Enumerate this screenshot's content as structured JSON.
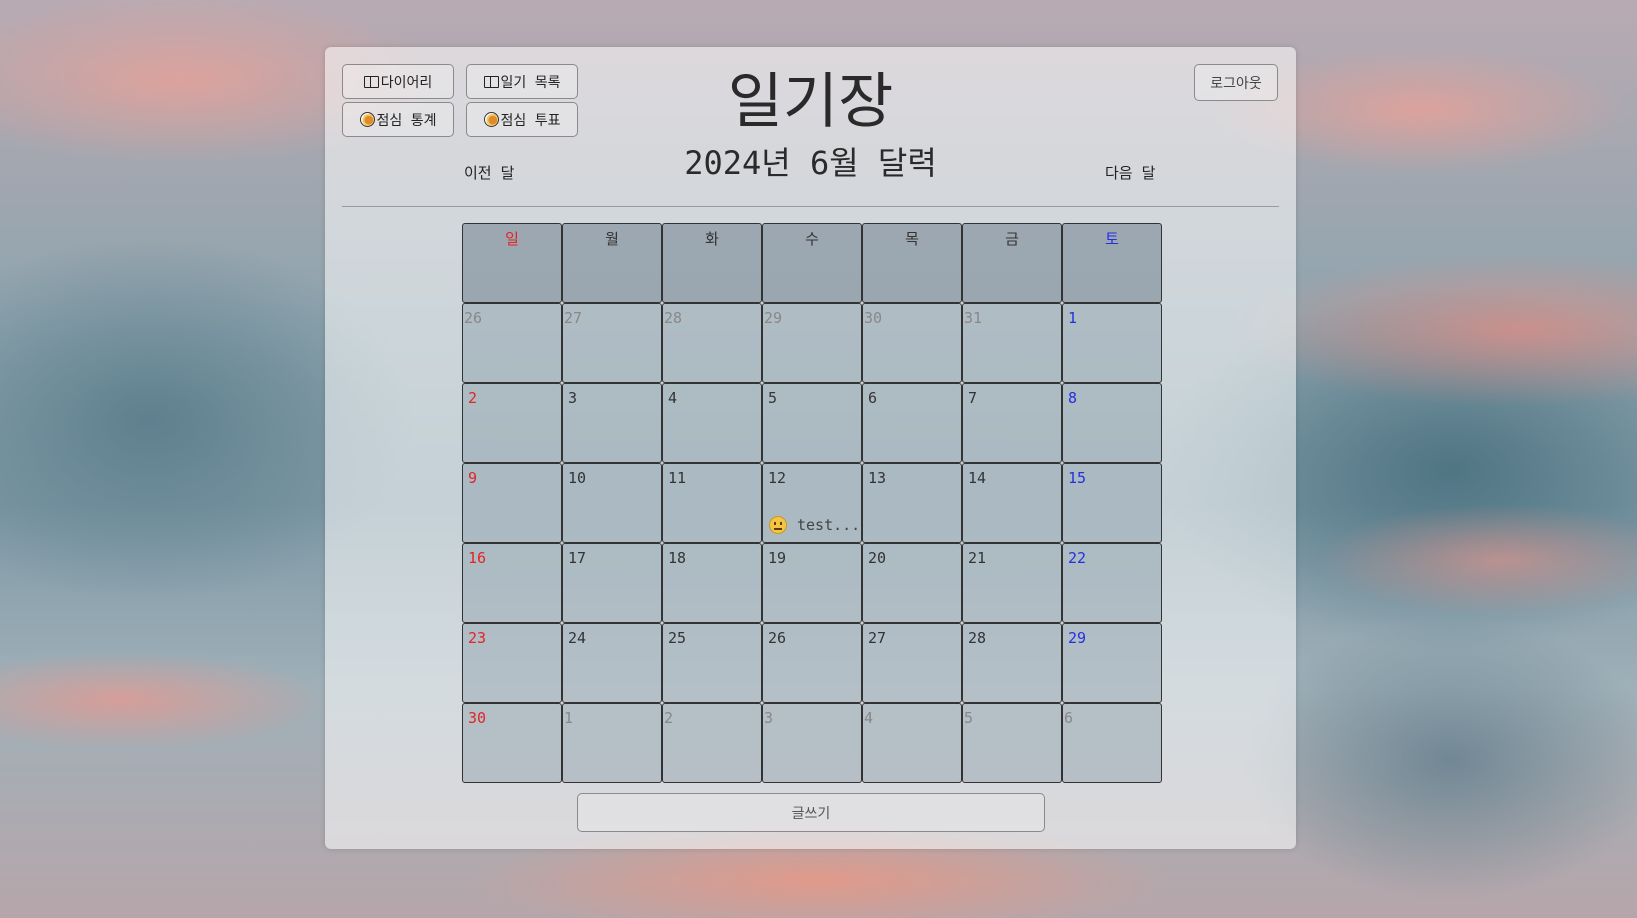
{
  "nav": {
    "diary": "다이어리",
    "diary_list": "일기 목록",
    "lunch_stats": "점심 통계",
    "lunch_vote": "점심 투표",
    "logout": "로그아웃"
  },
  "header": {
    "title": "일기장",
    "month_title": "2024년 6월 달력",
    "prev": "이전 달",
    "next": "다음 달"
  },
  "calendar": {
    "weekdays": [
      "일",
      "월",
      "화",
      "수",
      "목",
      "금",
      "토"
    ],
    "weeks": [
      [
        {
          "d": "26",
          "other": true
        },
        {
          "d": "27",
          "other": true
        },
        {
          "d": "28",
          "other": true
        },
        {
          "d": "29",
          "other": true
        },
        {
          "d": "30",
          "other": true
        },
        {
          "d": "31",
          "other": true
        },
        {
          "d": "1"
        }
      ],
      [
        {
          "d": "2"
        },
        {
          "d": "3"
        },
        {
          "d": "4"
        },
        {
          "d": "5"
        },
        {
          "d": "6"
        },
        {
          "d": "7"
        },
        {
          "d": "8"
        }
      ],
      [
        {
          "d": "9"
        },
        {
          "d": "10"
        },
        {
          "d": "11"
        },
        {
          "d": "12",
          "entry": "test..."
        },
        {
          "d": "13"
        },
        {
          "d": "14"
        },
        {
          "d": "15"
        }
      ],
      [
        {
          "d": "16"
        },
        {
          "d": "17"
        },
        {
          "d": "18"
        },
        {
          "d": "19"
        },
        {
          "d": "20"
        },
        {
          "d": "21"
        },
        {
          "d": "22"
        }
      ],
      [
        {
          "d": "23"
        },
        {
          "d": "24"
        },
        {
          "d": "25"
        },
        {
          "d": "26"
        },
        {
          "d": "27"
        },
        {
          "d": "28"
        },
        {
          "d": "29"
        }
      ],
      [
        {
          "d": "30"
        },
        {
          "d": "1",
          "other": true
        },
        {
          "d": "2",
          "other": true
        },
        {
          "d": "3",
          "other": true
        },
        {
          "d": "4",
          "other": true
        },
        {
          "d": "5",
          "other": true
        },
        {
          "d": "6",
          "other": true
        }
      ]
    ]
  },
  "write_button": "글쓰기",
  "colors": {
    "sunday": "#e02525",
    "saturday": "#2330e0"
  }
}
